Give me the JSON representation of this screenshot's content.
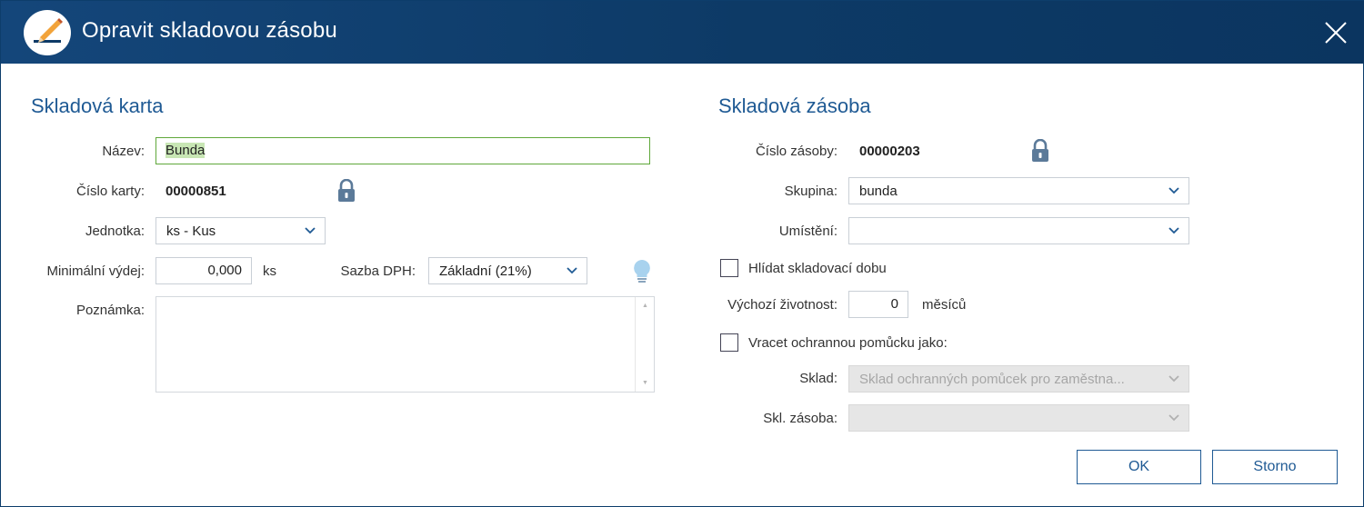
{
  "window": {
    "title": "Opravit skladovou zásobu"
  },
  "icons": {
    "app": "pencil-edit-icon",
    "close": "close-icon",
    "lock": "lock-icon",
    "bulb": "lightbulb-icon",
    "chevron": "chevron-down-icon"
  },
  "left": {
    "section_title": "Skladová karta",
    "nazev": {
      "label": "Název:",
      "value": "Bunda"
    },
    "cislo_karty": {
      "label": "Číslo karty:",
      "value": "00000851"
    },
    "jednotka": {
      "label": "Jednotka:",
      "value": "ks - Kus"
    },
    "min_vydej": {
      "label": "Minimální výdej:",
      "value": "0,000",
      "unit": "ks"
    },
    "sazba_dph": {
      "label": "Sazba DPH:",
      "value": "Základní (21%)"
    },
    "poznamka": {
      "label": "Poznámka:",
      "value": ""
    }
  },
  "right": {
    "section_title": "Skladová zásoba",
    "cislo_zasoby": {
      "label": "Číslo zásoby:",
      "value": "00000203"
    },
    "skupina": {
      "label": "Skupina:",
      "value": "bunda"
    },
    "umisteni": {
      "label": "Umístění:",
      "value": ""
    },
    "hlidat": {
      "label": "Hlídat skladovací dobu",
      "checked": false
    },
    "zivotnost": {
      "label": "Výchozí životnost:",
      "value": "0",
      "unit": "měsíců"
    },
    "vracet": {
      "label": "Vracet ochrannou pomůcku jako:",
      "checked": false
    },
    "sklad": {
      "label": "Sklad:",
      "value": "Sklad ochranných pomůcek pro zaměstna..."
    },
    "skl_zasoba": {
      "label": "Skl. zásoba:",
      "value": ""
    }
  },
  "buttons": {
    "ok": "OK",
    "storno": "Storno"
  },
  "colors": {
    "titlebar": "#0d3a66",
    "accent": "#1f5a94",
    "focus_border": "#5fa83a",
    "lock": "#5b7a99"
  }
}
